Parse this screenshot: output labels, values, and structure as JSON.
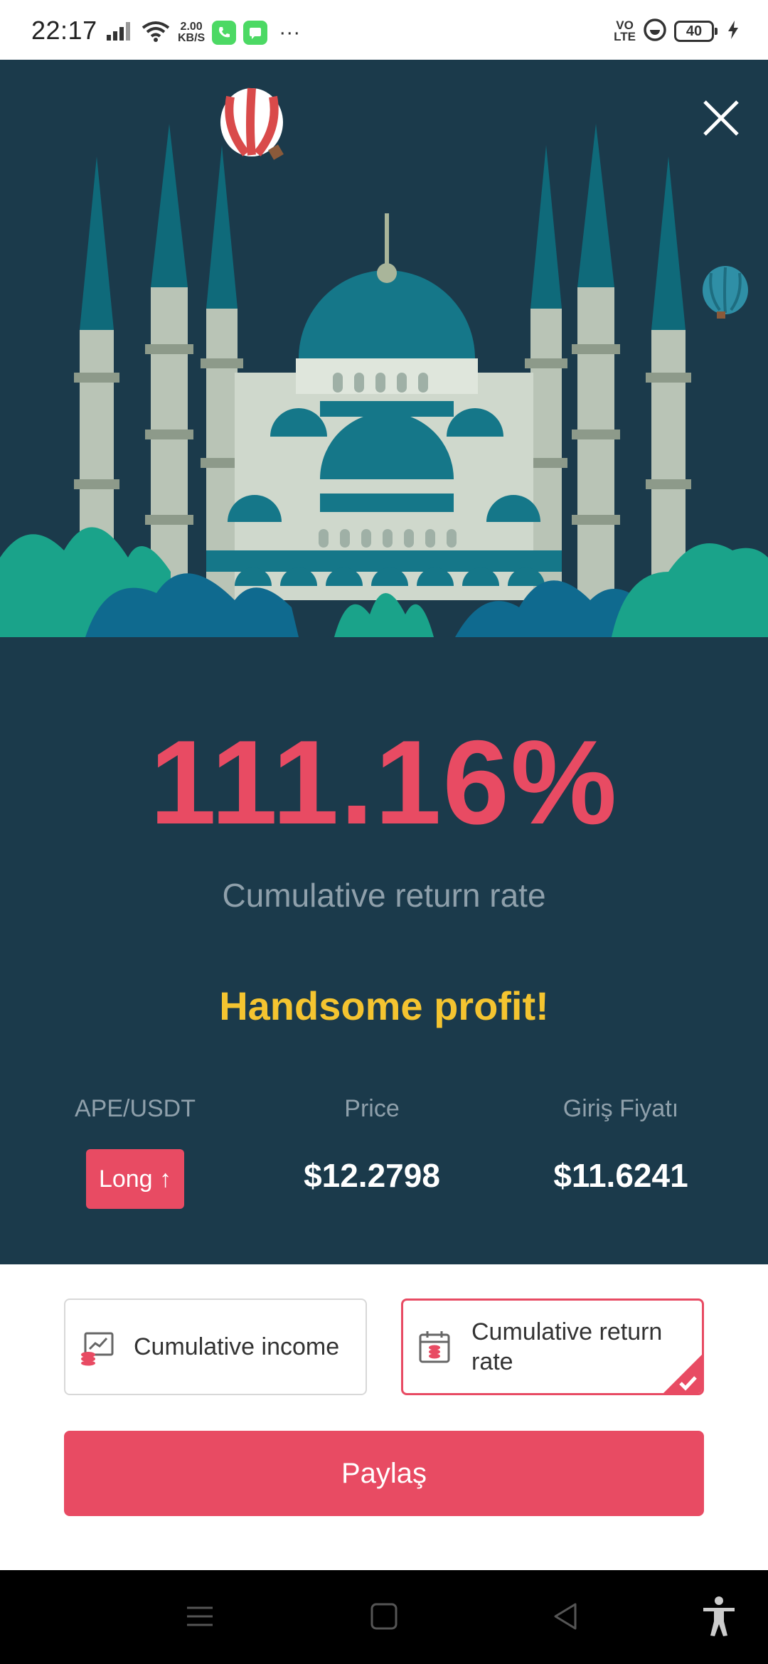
{
  "status_bar": {
    "time": "22:17",
    "speed_value": "2.00",
    "speed_unit": "KB/S",
    "dots": "···",
    "volte_top": "VO",
    "volte_bottom": "LTE",
    "battery": "40",
    "icons": [
      "signal-icon",
      "wifi-icon",
      "phone-app-icon",
      "message-app-icon",
      "dnd-icon",
      "charging-icon"
    ]
  },
  "card": {
    "rate_value": "111.16%",
    "rate_caption": "Cumulative return rate",
    "profit_text": "Handsome profit!",
    "pair_label": "APE/USDT",
    "direction_badge": "Long ↑",
    "price_label": "Price",
    "price_value": "$12.2798",
    "entry_label": "Giriş Fiyatı",
    "entry_value": "$11.6241"
  },
  "options": {
    "items": [
      {
        "label": "Cumulative income",
        "selected": false,
        "icon": "income-chart-icon"
      },
      {
        "label": "Cumulative return rate",
        "selected": true,
        "icon": "calendar-coins-icon"
      }
    ]
  },
  "share_button": "Paylaş",
  "colors": {
    "card_bg": "#1b3a4b",
    "accent_red": "#e84b63",
    "profit_yellow": "#f4c430",
    "muted_text": "#8fa0ab"
  },
  "nav_bar": {
    "icons": [
      "menu-icon",
      "home-icon",
      "back-icon",
      "accessibility-icon"
    ]
  }
}
